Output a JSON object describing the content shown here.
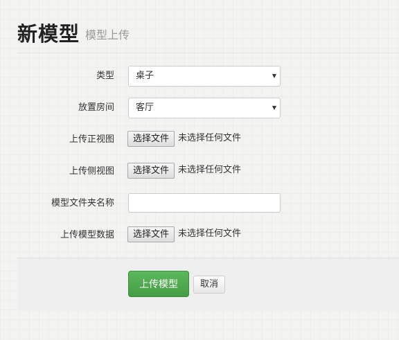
{
  "header": {
    "title": "新模型",
    "subtitle": "模型上传"
  },
  "form": {
    "type": {
      "label": "类型",
      "value": "桌子"
    },
    "room": {
      "label": "放置房间",
      "value": "客厅"
    },
    "front_view": {
      "label": "上传正视图",
      "button": "选择文件",
      "status": "未选择任何文件"
    },
    "side_view": {
      "label": "上传侧视图",
      "button": "选择文件",
      "status": "未选择任何文件"
    },
    "folder_name": {
      "label": "模型文件夹名称",
      "value": ""
    },
    "model_data": {
      "label": "上传模型数据",
      "button": "选择文件",
      "status": "未选择任何文件"
    }
  },
  "actions": {
    "submit": "上传模型",
    "cancel": "取消"
  },
  "icons": {
    "select_caret": "chevron-down-icon"
  },
  "colors": {
    "primary": "#5cb85c"
  }
}
